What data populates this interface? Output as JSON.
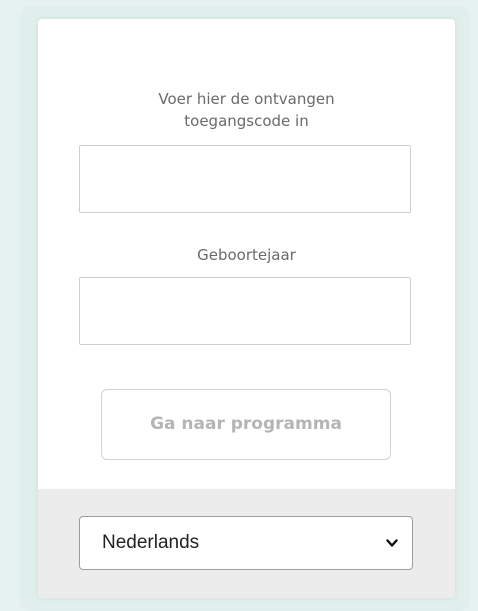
{
  "login": {
    "code_label": "Voer hier de ontvangen\ntoegangscode in",
    "code_label_line1": "Voer hier de ontvangen",
    "code_label_line2": "toegangscode in",
    "code_value": "",
    "year_label": "Geboortejaar",
    "year_value": "",
    "submit_label": "Ga naar programma"
  },
  "language": {
    "selected": "Nederlands",
    "icon": "chevron-down-icon"
  },
  "colors": {
    "background": "#e6f2ef",
    "card": "#ffffff",
    "footer": "#ececec",
    "button_text_disabled": "#b5b5b5",
    "label_text": "#6a6a6a"
  }
}
